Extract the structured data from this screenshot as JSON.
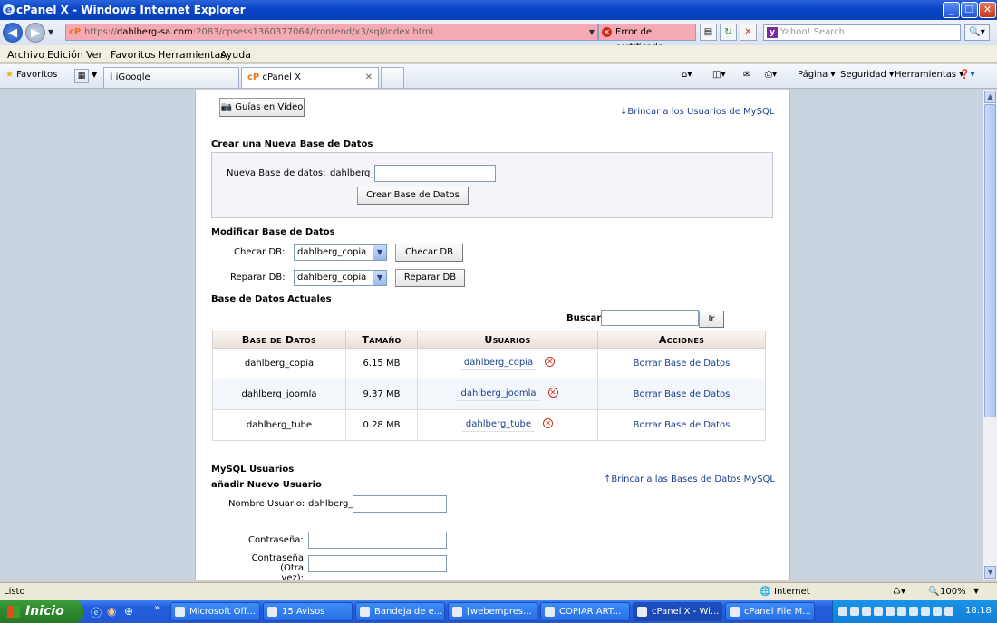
{
  "window": {
    "title": "cPanel X - Windows Internet Explorer"
  },
  "addressbar": {
    "url_domain": "dahlberg-sa.com",
    "url_prefix": "https://",
    "url_rest": ":2083/cpsess1360377064/frontend/x3/sql/index.html",
    "cert_error": "Error de certificado",
    "search_placeholder": "Yahoo! Search"
  },
  "menubar": {
    "items": [
      "Archivo",
      "Edición",
      "Ver",
      "Favoritos",
      "Herramientas",
      "Ayuda"
    ]
  },
  "favbar": {
    "favorites_label": "Favoritos",
    "tabs": [
      "iGoogle",
      "cPanel X"
    ],
    "right_items": [
      "Página ▾",
      "Seguridad ▾",
      "Herramientas ▾"
    ]
  },
  "page": {
    "video_guides_button": "Guías en Video",
    "jump_to_users_link": "↓Brincar a los Usuarios de MySQL",
    "create_db_heading": "Crear una Nueva Base de Datos",
    "new_db_label": "Nueva Base de datos:",
    "db_prefix": "dahlberg_",
    "create_db_button": "Crear Base de Datos",
    "modify_db_heading": "Modificar Base de Datos",
    "check_db_label": "Checar DB:",
    "check_db_selected": "dahlberg_copia",
    "check_db_button": "Checar DB",
    "repair_db_label": "Reparar DB:",
    "repair_db_selected": "dahlberg_copia",
    "repair_db_button": "Reparar DB",
    "current_db_heading": "Base de Datos Actuales",
    "search_label": "Buscar",
    "search_button": "Ir",
    "table": {
      "headers": [
        "Base de Datos",
        "Tamaño",
        "Usuarios",
        "Acciones"
      ],
      "rows": [
        {
          "db": "dahlberg_copia",
          "size": "6.15 MB",
          "user": "dahlberg_copia",
          "action": "Borrar Base de Datos"
        },
        {
          "db": "dahlberg_joomla",
          "size": "9.37 MB",
          "user": "dahlberg_joomla",
          "action": "Borrar Base de Datos"
        },
        {
          "db": "dahlberg_tube",
          "size": "0.28 MB",
          "user": "dahlberg_tube",
          "action": "Borrar Base de Datos"
        }
      ]
    },
    "mysql_users_heading": "MySQL Usuarios",
    "add_user_heading": "añadir Nuevo Usuario",
    "jump_to_dbs_link": "↑Brincar a las Bases de Datos MySQL",
    "username_label": "Nombre Usuario:",
    "user_prefix": "dahlberg_",
    "password_label": "Contraseña:",
    "password_again_label_1": "Contraseña (Otra",
    "password_again_label_2": "vez):"
  },
  "statusbar": {
    "status": "Listo",
    "zone": "Internet",
    "zoom": "100%"
  },
  "taskbar": {
    "start_label": "Inicio",
    "tasks": [
      "Microsoft Off...",
      "15 Avisos",
      "Bandeja de e...",
      "[webempres...",
      "COPIAR ART...",
      "cPanel X - Wi...",
      "cPanel File M..."
    ],
    "clock": "18:18"
  },
  "colors": {
    "title_blue": "#0a46c8",
    "link": "#1a3f8f",
    "page_bg": "#c7d3de",
    "cert_error_bg": "#f5a9b4"
  }
}
